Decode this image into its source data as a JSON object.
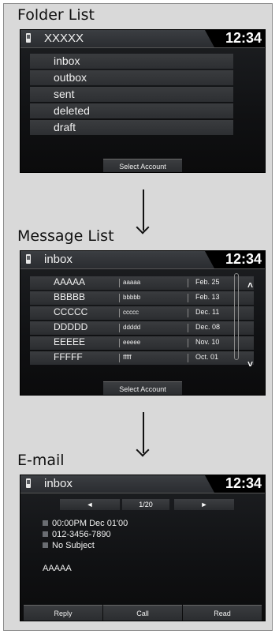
{
  "sections": {
    "folder_list": "Folder List",
    "message_list": "Message List",
    "email": "E-mail"
  },
  "clock": "12:34",
  "folder_screen": {
    "title": "XXXXX",
    "folders": [
      "inbox",
      "outbox",
      "sent",
      "deleted",
      "draft"
    ],
    "select_account": "Select Account"
  },
  "message_screen": {
    "title": "inbox",
    "messages": [
      {
        "name": "AAAAA",
        "subject": "aaaaa",
        "date": "Feb. 25"
      },
      {
        "name": "BBBBB",
        "subject": "bbbbb",
        "date": "Feb. 13"
      },
      {
        "name": "CCCCC",
        "subject": "ccccc",
        "date": "Dec. 11"
      },
      {
        "name": "DDDDD",
        "subject": "ddddd",
        "date": "Dec. 08"
      },
      {
        "name": "EEEEE",
        "subject": "eeeee",
        "date": "Nov. 10"
      },
      {
        "name": "FFFFF",
        "subject": "fffff",
        "date": "Oct. 01"
      }
    ],
    "select_account": "Select Account",
    "scroll_up_icon": "double-chevron-up",
    "scroll_down_icon": "double-chevron-down"
  },
  "email_screen": {
    "title": "inbox",
    "prev_label": "◄",
    "next_label": "►",
    "page": "1/20",
    "datetime": "00:00PM Dec 01'00",
    "phone": "012-3456-7890",
    "subject": "No Subject",
    "body": "AAAAA",
    "buttons": [
      "Reply",
      "Call",
      "Read"
    ]
  }
}
